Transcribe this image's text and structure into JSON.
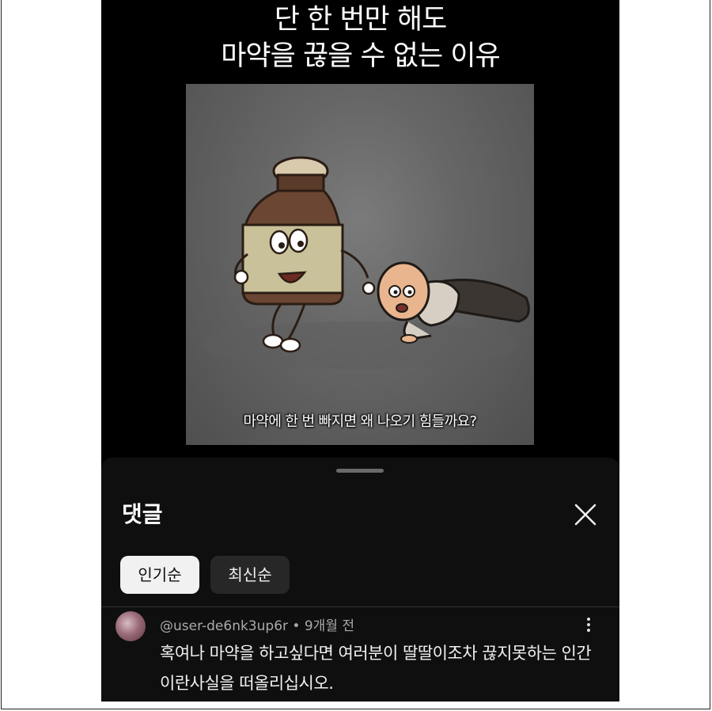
{
  "post": {
    "title_line1": "단 한 번만 해도",
    "title_line2": "마약을 끊을 수 없는 이유"
  },
  "video": {
    "subtitle": "마약에 한 번 빠지면 왜 나오기 힘들까요?"
  },
  "comments_sheet": {
    "title": "댓글",
    "close_icon": "close-icon",
    "sort_chips": [
      {
        "label": "인기순",
        "selected": true
      },
      {
        "label": "최신순",
        "selected": false
      }
    ],
    "comments": [
      {
        "username": "@user-de6nk3up6r",
        "separator": " • ",
        "time": "9개월 전",
        "text": "혹여나 마약을 하고싶다면 여러분이 딸딸이조차 끊지못하는 인간이란사실을 떠올리십시오."
      }
    ]
  },
  "colors": {
    "background": "#000000",
    "sheet": "#0f0f0f",
    "chip_selected": "#f1f1f1",
    "chip_unselected": "#272727"
  }
}
